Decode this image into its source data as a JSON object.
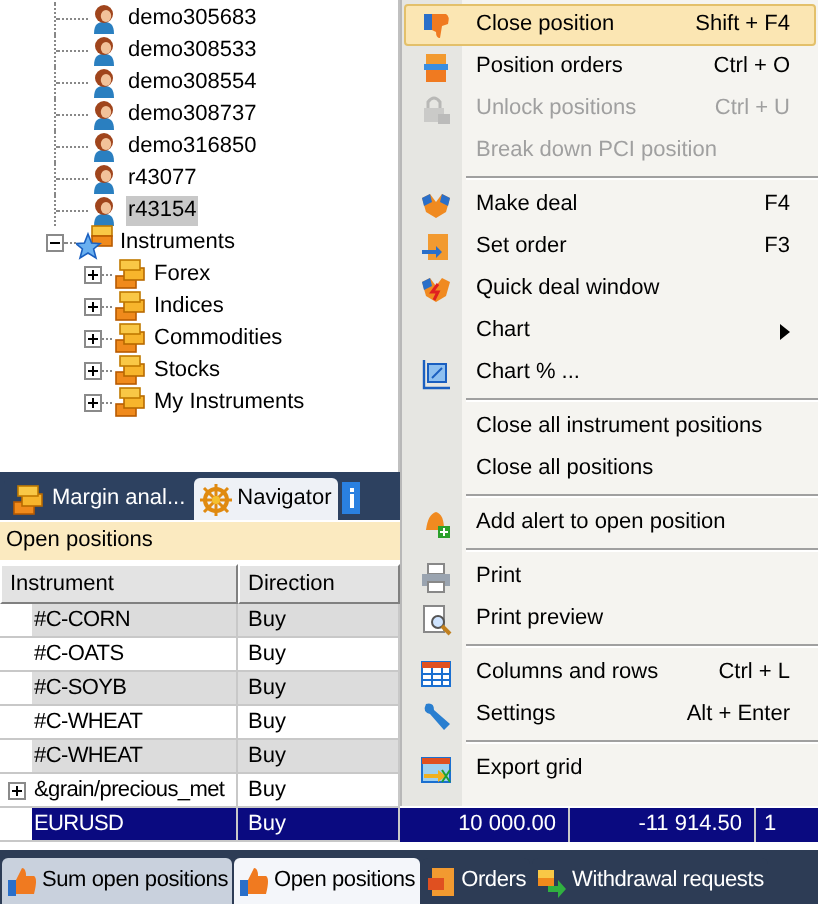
{
  "tree": {
    "accounts": [
      {
        "label": "demo305683",
        "selected": false
      },
      {
        "label": "demo308533",
        "selected": false
      },
      {
        "label": "demo308554",
        "selected": false
      },
      {
        "label": "demo308737",
        "selected": false
      },
      {
        "label": "demo316850",
        "selected": false
      },
      {
        "label": "r43077",
        "selected": false
      },
      {
        "label": "r43154",
        "selected": true
      }
    ],
    "instruments": {
      "label": "Instruments",
      "expanded": true,
      "children": [
        {
          "label": "Forex",
          "expanded": false
        },
        {
          "label": "Indices",
          "expanded": false
        },
        {
          "label": "Commodities",
          "expanded": false
        },
        {
          "label": "Stocks",
          "expanded": false
        },
        {
          "label": "My Instruments",
          "expanded": false
        }
      ]
    }
  },
  "panel_tabs": [
    {
      "label": "Margin anal...",
      "selected": false
    },
    {
      "label": "Navigator",
      "selected": true
    }
  ],
  "open_positions": {
    "title": "Open positions",
    "columns": [
      "Instrument",
      "Direction"
    ],
    "rows": [
      {
        "instrument": "#C-CORN",
        "direction": "Buy",
        "selected": false,
        "expandable": false
      },
      {
        "instrument": "#C-OATS",
        "direction": "Buy",
        "selected": false,
        "expandable": false
      },
      {
        "instrument": "#C-SOYB",
        "direction": "Buy",
        "selected": false,
        "expandable": false
      },
      {
        "instrument": "#C-WHEAT",
        "direction": "Buy",
        "selected": false,
        "expandable": false
      },
      {
        "instrument": "#C-WHEAT",
        "direction": "Buy",
        "selected": false,
        "expandable": false
      },
      {
        "instrument": "&grain/precious_met",
        "direction": "Buy",
        "selected": false,
        "expandable": true
      },
      {
        "instrument": "EURUSD",
        "direction": "Buy",
        "selected": true,
        "expandable": false,
        "column_3": "10 000.00",
        "column_4": "-11 914.50",
        "column_5": "1"
      }
    ]
  },
  "context_menu": {
    "items": [
      {
        "kind": "item",
        "label": "Close position",
        "shortcut": "Shift + F4",
        "highlighted": true,
        "disabled": false
      },
      {
        "kind": "item",
        "label": "Position orders",
        "shortcut": "Ctrl + O",
        "highlighted": false,
        "disabled": false
      },
      {
        "kind": "item",
        "label": "Unlock positions",
        "shortcut": "Ctrl + U",
        "highlighted": false,
        "disabled": true
      },
      {
        "kind": "item",
        "label": "Break down PCI position",
        "highlighted": false,
        "disabled": true
      },
      {
        "kind": "separator"
      },
      {
        "kind": "item",
        "label": "Make deal",
        "shortcut": "F4",
        "highlighted": false,
        "disabled": false
      },
      {
        "kind": "item",
        "label": "Set order",
        "shortcut": "F3",
        "highlighted": false,
        "disabled": false
      },
      {
        "kind": "item",
        "label": "Quick deal window",
        "highlighted": false,
        "disabled": false
      },
      {
        "kind": "item",
        "label": "Chart",
        "highlighted": false,
        "disabled": false,
        "submenu": true
      },
      {
        "kind": "item",
        "label": "Chart % ...",
        "highlighted": false,
        "disabled": false
      },
      {
        "kind": "separator"
      },
      {
        "kind": "item",
        "label": "Close all instrument positions",
        "highlighted": false,
        "disabled": false
      },
      {
        "kind": "item",
        "label": "Close all positions",
        "highlighted": false,
        "disabled": false
      },
      {
        "kind": "separator"
      },
      {
        "kind": "item",
        "label": "Add alert to open position",
        "highlighted": false,
        "disabled": false
      },
      {
        "kind": "separator"
      },
      {
        "kind": "item",
        "label": "Print",
        "highlighted": false,
        "disabled": false
      },
      {
        "kind": "item",
        "label": "Print preview",
        "highlighted": false,
        "disabled": false
      },
      {
        "kind": "separator"
      },
      {
        "kind": "item",
        "label": "Columns and rows",
        "shortcut": "Ctrl + L",
        "highlighted": false,
        "disabled": false
      },
      {
        "kind": "item",
        "label": "Settings",
        "shortcut": "Alt + Enter",
        "highlighted": false,
        "disabled": false
      },
      {
        "kind": "separator"
      },
      {
        "kind": "item",
        "label": "Export grid",
        "highlighted": false,
        "disabled": false
      }
    ]
  },
  "bottom_tabs": [
    {
      "label": "Sum open positions",
      "selected": false
    },
    {
      "label": "Open positions",
      "selected": true
    },
    {
      "label": "Orders",
      "selected": false
    },
    {
      "label": "Withdrawal requests",
      "selected": false
    }
  ]
}
